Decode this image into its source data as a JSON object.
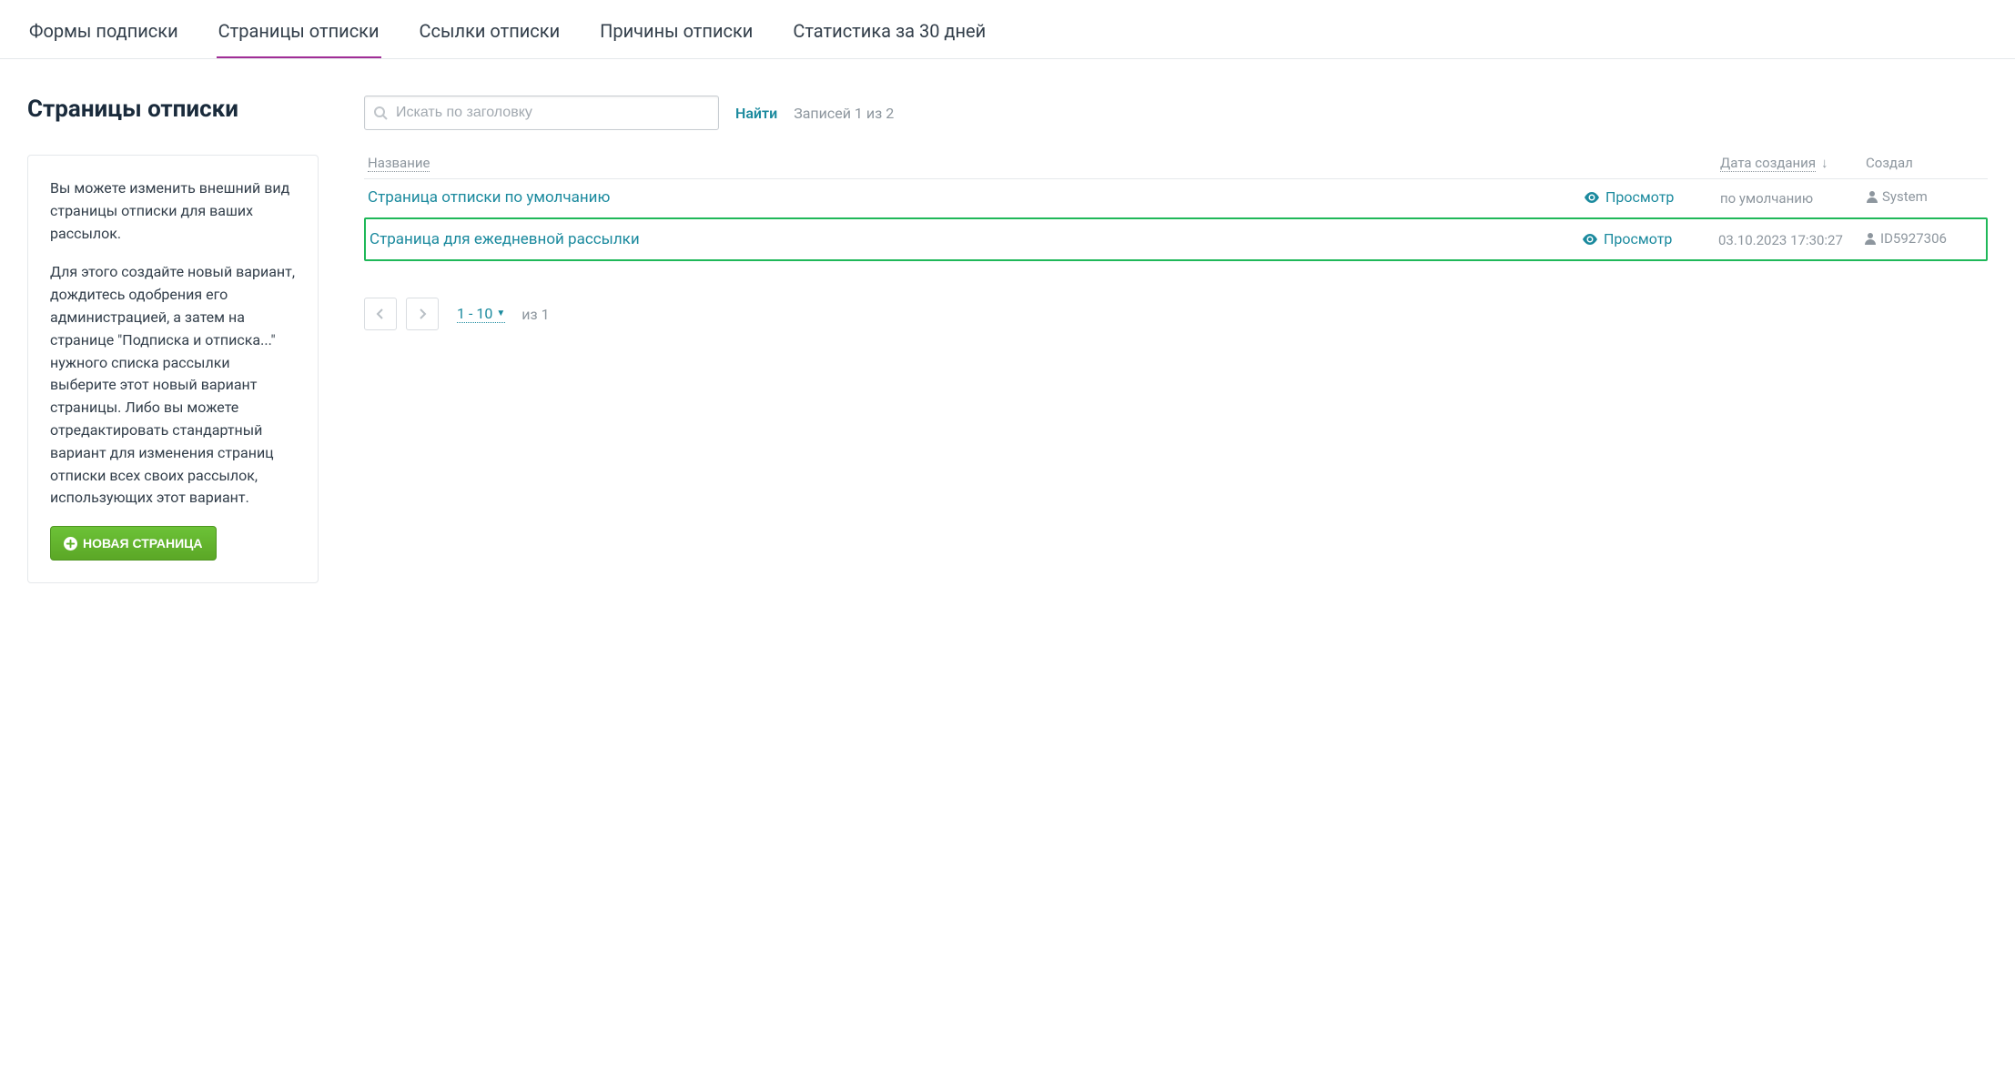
{
  "tabs": [
    {
      "label": "Формы подписки"
    },
    {
      "label": "Страницы отписки"
    },
    {
      "label": "Ссылки отписки"
    },
    {
      "label": "Причины отписки"
    },
    {
      "label": "Статистика за 30 дней"
    }
  ],
  "active_tab_index": 1,
  "sidebar": {
    "page_title": "Страницы отписки",
    "info_paragraph_1": "Вы можете изменить внешний вид страницы отписки для ваших рассылок.",
    "info_paragraph_2": "Для этого создайте новый вариант, дождитесь одобрения его администрацией, а затем на странице \"Подписка и отписка...\" нужного списка рассылки выберите этот новый вариант страницы. Либо вы можете отредактировать стандартный вариант для изменения страниц отписки всех своих рассылок, использующих этот вариант.",
    "new_page_button": "НОВАЯ СТРАНИЦА"
  },
  "search": {
    "placeholder": "Искать по заголовку",
    "find_label": "Найти",
    "records_label": "Записей 1 из 2"
  },
  "table": {
    "headers": {
      "name": "Название",
      "date": "Дата создания",
      "creator": "Создал"
    },
    "preview_label": "Просмотр",
    "rows": [
      {
        "name": "Страница отписки по умолчанию",
        "date": "по умолчанию",
        "creator": "System",
        "highlighted": false
      },
      {
        "name": "Страница для ежедневной рассылки",
        "date": "03.10.2023 17:30:27",
        "creator": "ID5927306",
        "highlighted": true
      }
    ]
  },
  "pagination": {
    "range": "1 - 10",
    "of_label": "из 1"
  }
}
